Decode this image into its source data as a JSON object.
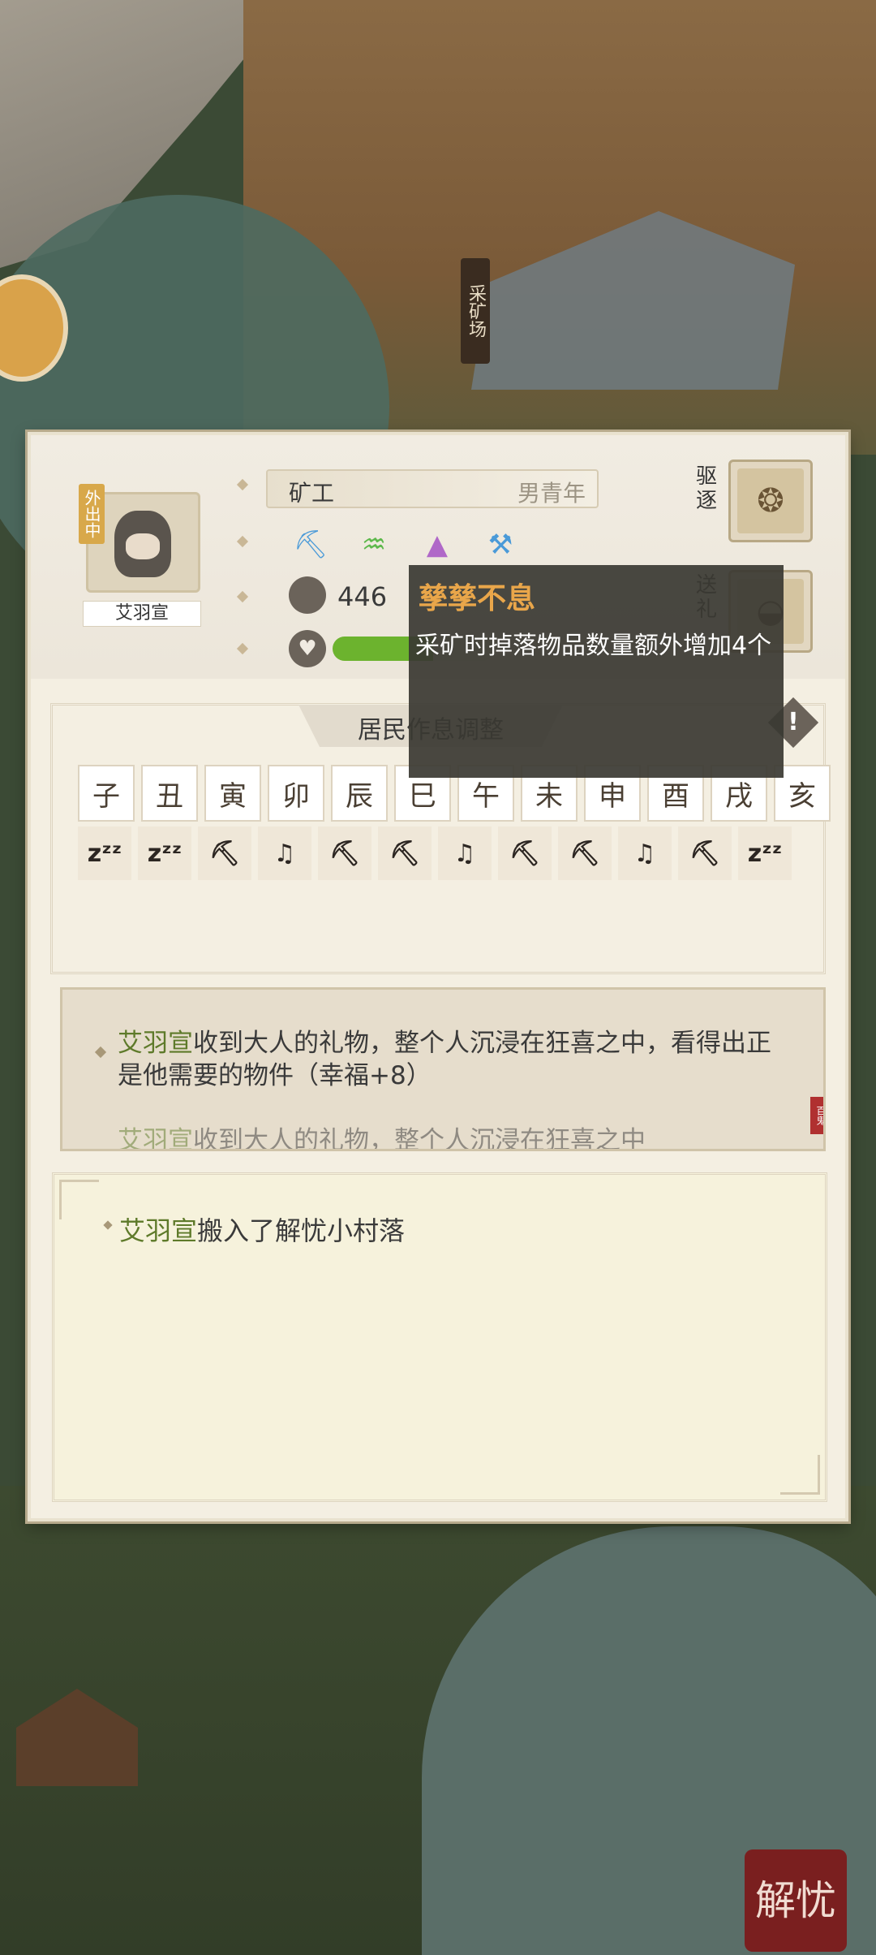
{
  "map": {
    "mine_sign": "采矿场",
    "seal": "解忧"
  },
  "resident": {
    "status_badge": "外出中",
    "name": "艾羽宣",
    "job": "矿工",
    "gender_age": "男青年",
    "tool_icons": [
      "pickaxe-icon",
      "lamp-icon",
      "ore-pile-icon",
      "crossed-picks-icon"
    ],
    "ore_count": "446",
    "happiness_fraction": 0.62
  },
  "actions": {
    "expel": "驱逐",
    "gift": "送礼"
  },
  "tooltip": {
    "title": "孳孳不息",
    "description": "采矿时掉落物品数量额外增加4个"
  },
  "schedule": {
    "title": "居民作息调整",
    "hours": [
      "子",
      "丑",
      "寅",
      "卯",
      "辰",
      "巳",
      "午",
      "未",
      "申",
      "酉",
      "戌",
      "亥"
    ],
    "activities": [
      "sleep",
      "sleep",
      "mine",
      "leisure",
      "mine",
      "mine",
      "leisure",
      "mine",
      "mine",
      "leisure",
      "mine",
      "sleep"
    ]
  },
  "log_recent": {
    "entries": [
      {
        "name": "艾羽宣",
        "text": "收到大人的礼物，整个人沉浸在狂喜之中，看得出正是他需要的物件（幸福+8）"
      },
      {
        "name": "艾羽宣",
        "text": "收到大人的礼物，整个人沉浸在狂喜之中"
      }
    ],
    "stamp": "百鬼"
  },
  "log_history": {
    "entries": [
      {
        "name": "艾羽宣",
        "text": "搬入了解忧小村落"
      }
    ]
  },
  "colors": {
    "highlight": "#5e7a2a",
    "tooltip_title": "#e9a64a",
    "hp_fill": "#6cb32e"
  }
}
